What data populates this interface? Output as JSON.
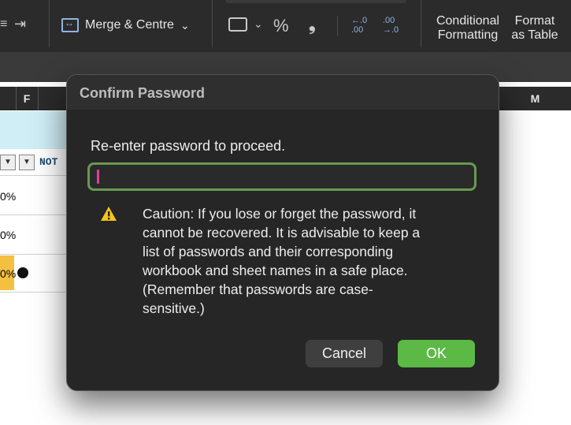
{
  "ribbon": {
    "merge_label": "Merge & Centre",
    "merge_caret": "⌄",
    "percent_label": "%",
    "comma_label": "❟",
    "increase_decimal": "←.0\n.00",
    "decrease_decimal": ".00\n→.0",
    "conditional_formatting_line1": "Conditional",
    "conditional_formatting_line2": "Formatting",
    "format_table_line1": "Format",
    "format_table_line2": "as Table"
  },
  "sheet": {
    "columns": [
      "F",
      "M"
    ],
    "header_text": "NOT",
    "filter_glyph": "▼",
    "rows": [
      "0%",
      "0%",
      "0%"
    ]
  },
  "dialog": {
    "title": "Confirm Password",
    "prompt": "Re-enter password to proceed.",
    "password_value": "",
    "caution_lines": [
      "Caution: If you lose or forget the password, it",
      "cannot be recovered. It is advisable to keep a",
      "list of passwords and their corresponding",
      "workbook and sheet names in a safe place.",
      "(Remember that passwords are case-",
      "sensitive.)"
    ],
    "cancel_label": "Cancel",
    "ok_label": "OK"
  },
  "colors": {
    "dialog_bg": "#262626",
    "ok_green": "#5cb946",
    "field_border": "#6a9950",
    "caret": "#e0409a",
    "warning_yellow": "#f5c518"
  },
  "icons": [
    "indent-icon",
    "merge-icon",
    "cell-styles-icon",
    "warning-icon"
  ]
}
